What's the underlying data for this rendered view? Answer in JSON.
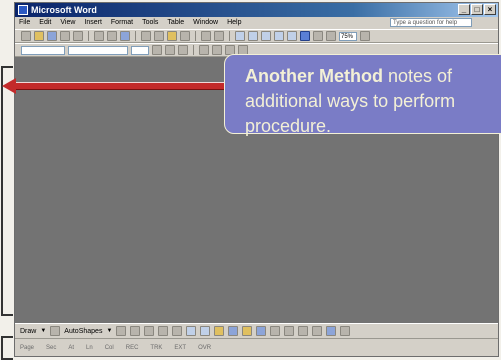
{
  "window": {
    "title": "Microsoft Word"
  },
  "menu": [
    "File",
    "Edit",
    "View",
    "Insert",
    "Format",
    "Tools",
    "Table",
    "Window",
    "Help"
  ],
  "help_box": {
    "placeholder": "Type a question for help"
  },
  "toolbar": {
    "zoom": "75%"
  },
  "drawing": {
    "draw_label": "Draw",
    "autoshapes_label": "AutoShapes"
  },
  "status_bar": [
    "Page",
    "Sec",
    "At",
    "Ln",
    "Col",
    "REC",
    "TRK",
    "EXT",
    "OVR"
  ],
  "callout": {
    "bold": "Another Method",
    "line1_rest": " notes of",
    "line2": "additional ways to perform",
    "line3": "procedure."
  },
  "colors": {
    "callout_fill": "#7a7cc6",
    "callout_text": "#f3f0d6",
    "arrow": "#c32a2a",
    "titlebar": "#0a246a",
    "document_area": "#737373"
  },
  "icons": [
    "app-icon",
    "minimize-icon",
    "maximize-icon",
    "close-icon",
    "new-doc-icon",
    "open-icon",
    "save-icon",
    "print-icon",
    "undo-icon",
    "redo-icon",
    "bold-icon",
    "italic-icon",
    "underline-icon",
    "arrow-icon",
    "line-icon",
    "rectangle-icon",
    "oval-icon",
    "textbox-icon",
    "fill-color-icon",
    "line-color-icon",
    "font-color-icon"
  ]
}
